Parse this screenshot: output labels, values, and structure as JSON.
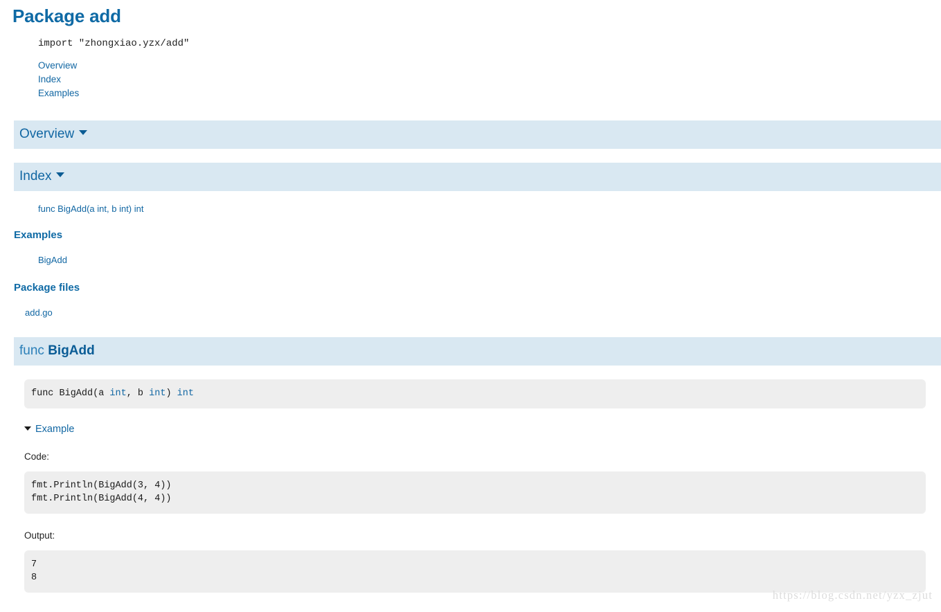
{
  "page": {
    "title": "Package add",
    "import_statement": "import \"zhongxiao.yzx/add\""
  },
  "top_nav": {
    "items": [
      {
        "label": "Overview"
      },
      {
        "label": "Index"
      },
      {
        "label": "Examples"
      }
    ]
  },
  "sections": {
    "overview": {
      "label": "Overview",
      "caret": "chevron-down-icon"
    },
    "index": {
      "label": "Index",
      "caret": "chevron-down-icon"
    },
    "func_bigadd": {
      "keyword": "func",
      "name": "BigAdd",
      "caret": "chevron-down-icon"
    }
  },
  "index": {
    "entries": [
      {
        "label": "func BigAdd(a int, b int) int"
      }
    ],
    "examples_heading": "Examples",
    "examples": [
      {
        "label": "BigAdd"
      }
    ],
    "package_files_heading": "Package files",
    "package_files": [
      {
        "label": "add.go"
      }
    ]
  },
  "func_detail": {
    "signature": {
      "prefix": "func BigAdd(a ",
      "kw1": "int",
      "mid": ", b ",
      "kw2": "int",
      "suffix": ") ",
      "kw3": "int"
    },
    "example_toggle_label": "Example",
    "code_label": "Code:",
    "code_body": "fmt.Println(BigAdd(3, 4))\nfmt.Println(BigAdd(4, 4))",
    "output_label": "Output:",
    "output_body": "7\n8"
  },
  "watermark": {
    "text": "https://blog.csdn.net/yzx_zjut"
  },
  "colors": {
    "link": "#1267a3",
    "heading": "#0f6aa5",
    "section_bar_bg": "#d9e8f2",
    "code_bg": "#eeeeee",
    "watermark": "#dcdcdc"
  }
}
